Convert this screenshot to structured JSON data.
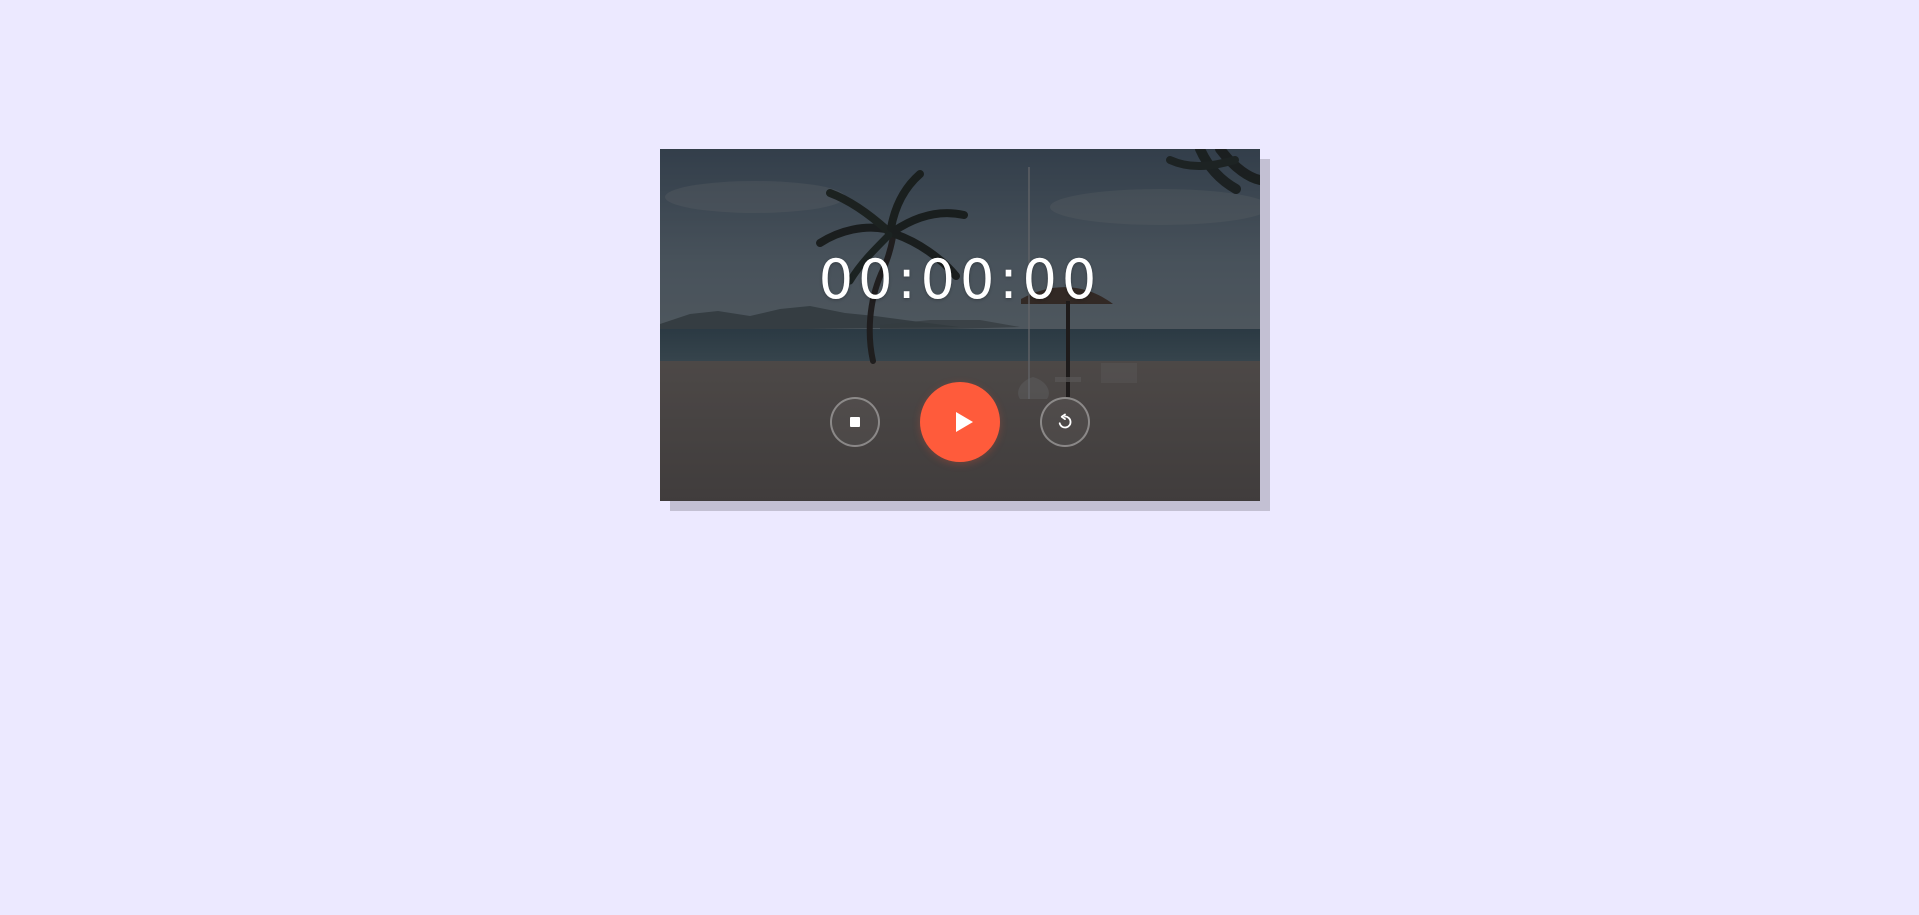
{
  "timer": {
    "display": "00:00:00"
  },
  "controls": {
    "stop_icon": "stop-icon",
    "play_icon": "play-icon",
    "reset_icon": "reset-icon"
  },
  "colors": {
    "page_background": "#ece9ff",
    "play_button": "#ff5b3b",
    "card_shadow": "#c3c0d3"
  }
}
